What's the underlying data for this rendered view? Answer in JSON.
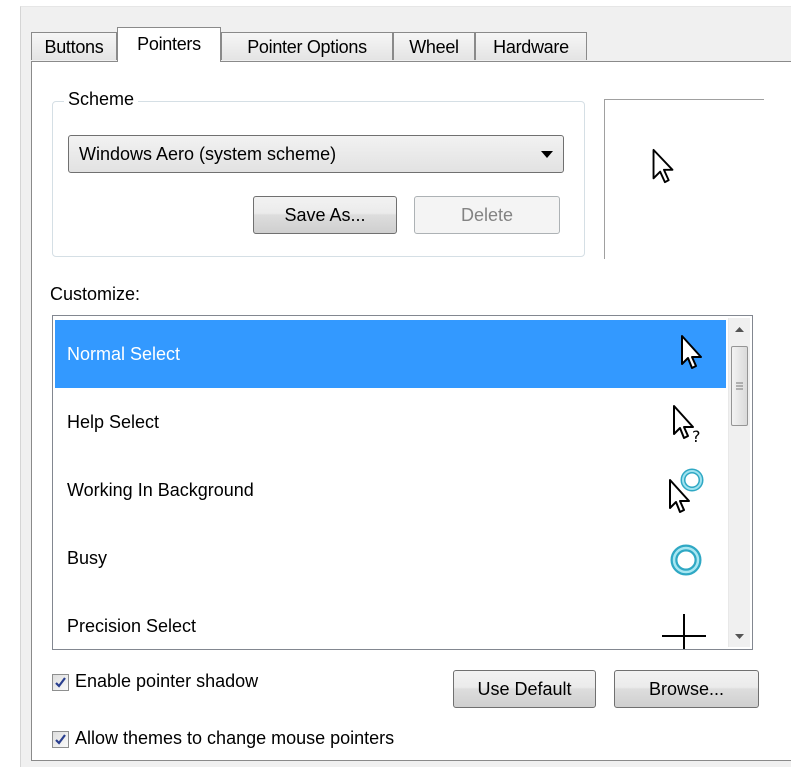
{
  "tabs": [
    {
      "label": "Buttons"
    },
    {
      "label": "Pointers",
      "active": true
    },
    {
      "label": "Pointer Options"
    },
    {
      "label": "Wheel"
    },
    {
      "label": "Hardware"
    }
  ],
  "scheme": {
    "group_label": "Scheme",
    "selected": "Windows Aero (system scheme)",
    "save_as_label": "Save As...",
    "delete_label": "Delete"
  },
  "customize": {
    "label": "Customize:",
    "items": [
      {
        "label": "Normal Select",
        "icon": "arrow-pointer-icon",
        "selected": true
      },
      {
        "label": "Help Select",
        "icon": "help-pointer-icon"
      },
      {
        "label": "Working In Background",
        "icon": "working-background-pointer-icon"
      },
      {
        "label": "Busy",
        "icon": "busy-ring-icon"
      },
      {
        "label": "Precision Select",
        "icon": "crosshair-pointer-icon"
      }
    ]
  },
  "options": {
    "shadow_label": "Enable pointer shadow",
    "shadow_checked": true,
    "themes_label": "Allow themes to change mouse pointers",
    "themes_checked": true
  },
  "buttons": {
    "use_default_label": "Use Default",
    "browse_label": "Browse..."
  },
  "colors": {
    "selection": "#3399ff",
    "busy_ring": "#2fa8c4"
  }
}
